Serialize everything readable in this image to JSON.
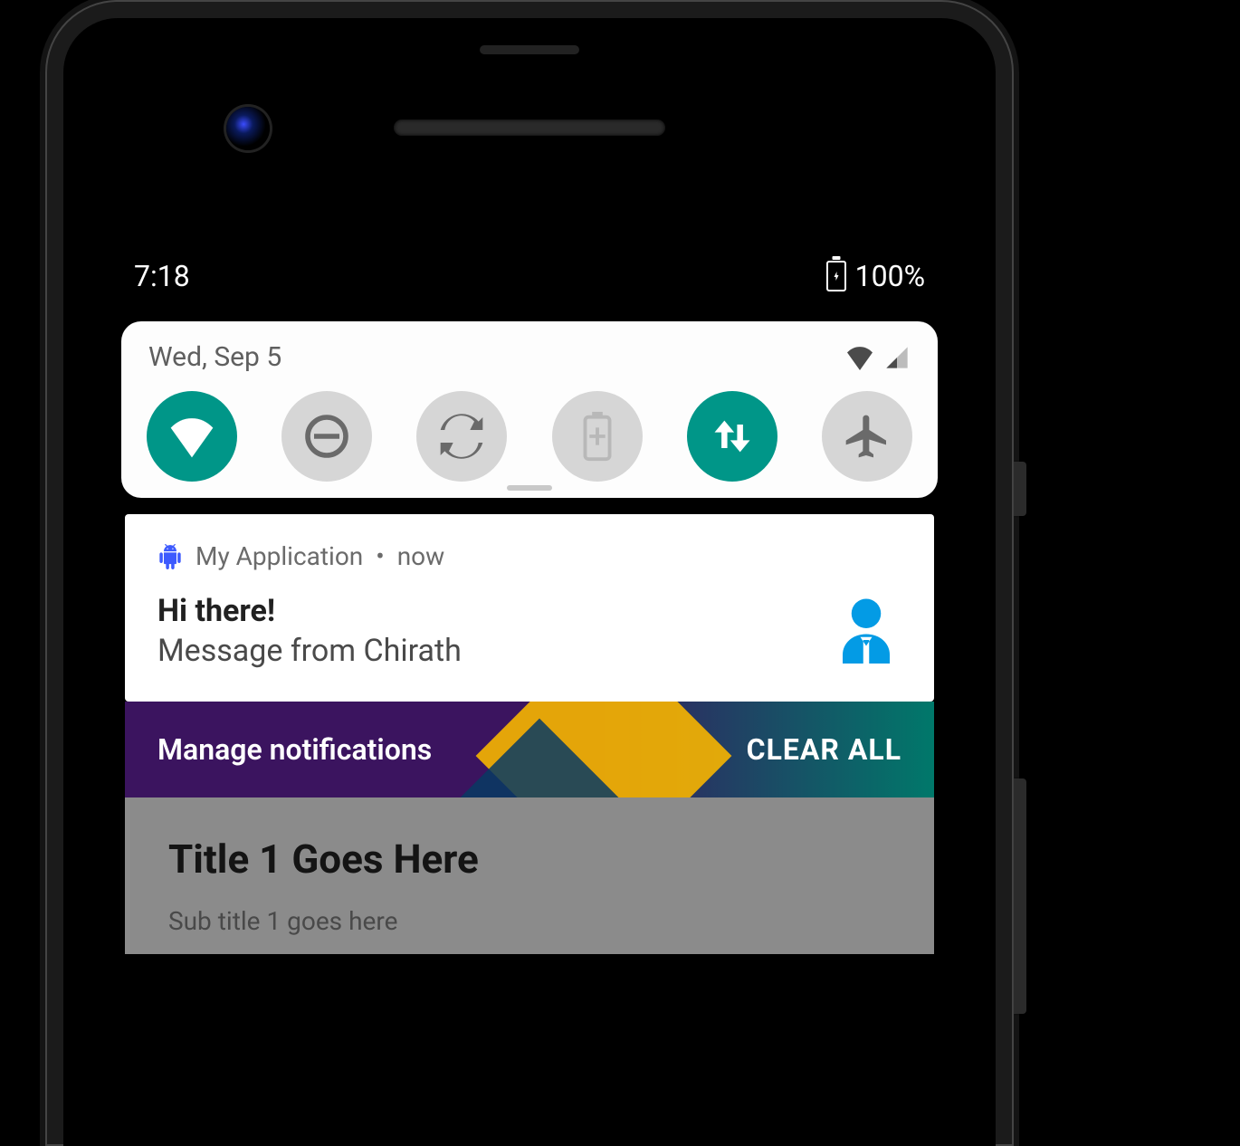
{
  "status_bar": {
    "time": "7:18",
    "battery_pct": "100%"
  },
  "quick_settings": {
    "date": "Wed, Sep 5",
    "tiles": [
      {
        "id": "wifi",
        "icon": "wifi-icon",
        "on": true
      },
      {
        "id": "dnd",
        "icon": "dnd-icon",
        "on": false
      },
      {
        "id": "autorotate",
        "icon": "autorotate-icon",
        "on": false
      },
      {
        "id": "battery",
        "icon": "battery-saver-icon",
        "on": false
      },
      {
        "id": "mobiledata",
        "icon": "data-arrows-icon",
        "on": true
      },
      {
        "id": "airplane",
        "icon": "airplane-icon",
        "on": false
      }
    ]
  },
  "notification": {
    "app_name": "My Application",
    "time": "now",
    "separator": "•",
    "title": "Hi there!",
    "text": "Message from Chirath",
    "large_icon": "person-icon"
  },
  "footer": {
    "manage_label": "Manage notifications",
    "clear_label": "CLEAR ALL"
  },
  "dimmed": {
    "title": "Title 1 Goes Here",
    "subtitle": "Sub title 1 goes here"
  },
  "colors": {
    "accent": "#009688",
    "notif_icon": "#039be5"
  }
}
